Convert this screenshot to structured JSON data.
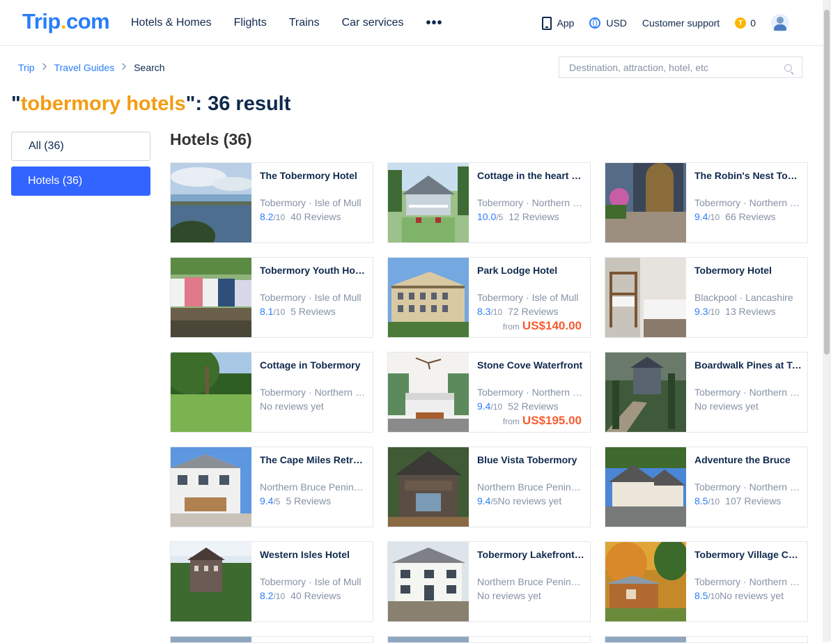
{
  "header": {
    "logo_main": "Trip",
    "logo_dot": ".",
    "logo_suffix": "com",
    "nav": [
      "Hotels & Homes",
      "Flights",
      "Trains",
      "Car services"
    ],
    "more": "•••",
    "app_label": "App",
    "currency_label": "USD",
    "support_label": "Customer support",
    "coins_count": "0",
    "coin_symbol": "T"
  },
  "breadcrumb": {
    "items": [
      "Trip",
      "Travel Guides"
    ],
    "separator": ">",
    "current": "Search"
  },
  "search": {
    "placeholder": "Destination, attraction, hotel, etc",
    "value": ""
  },
  "results": {
    "quote_open": "\"",
    "keyword": "tobermory hotels",
    "suffix": "\": 36 result"
  },
  "filters": {
    "all": "All (36)",
    "hotels": "Hotels (36)"
  },
  "section_title": "Hotels (36)",
  "cards": [
    {
      "name": "The Tobermory Hotel",
      "location": "Tobermory · Isle of Mull",
      "score": "8.2",
      "scale": "/10",
      "reviews": "40 Reviews",
      "price_from": "",
      "price": "",
      "thumb": "lake"
    },
    {
      "name": "Cottage in the heart of Tobermory",
      "location": "Tobermory · Northern Bruce Peninsula",
      "score": "10.0",
      "scale": "/5",
      "reviews": "12 Reviews",
      "price_from": "",
      "price": "",
      "thumb": "cottage"
    },
    {
      "name": "The Robin's Nest Tobermory",
      "location": "Tobermory · Northern Bruce Peninsula",
      "score": "9.4",
      "scale": "/10",
      "reviews": "66 Reviews",
      "price_from": "",
      "price": "",
      "thumb": "deck"
    },
    {
      "name": "Tobermory Youth Hostel",
      "location": "Tobermory · Isle of Mull",
      "score": "8.1",
      "scale": "/10",
      "reviews": "5 Reviews",
      "price_from": "",
      "price": "",
      "thumb": "colorful"
    },
    {
      "name": "Park Lodge Hotel",
      "location": "Tobermory · Isle of Mull",
      "score": "8.3",
      "scale": "/10",
      "reviews": "72 Reviews",
      "price_from": "from",
      "price": "US$140.00",
      "thumb": "lodge"
    },
    {
      "name": "Tobermory Hotel",
      "location": "Blackpool · Lancashire",
      "score": "9.3",
      "scale": "/10",
      "reviews": "13 Reviews",
      "price_from": "",
      "price": "",
      "thumb": "bunk"
    },
    {
      "name": "Cottage in Tobermory",
      "location": "Tobermory · Northern Bruce Peninsula",
      "score": "",
      "scale": "",
      "reviews": "No reviews yet",
      "price_from": "",
      "price": "",
      "thumb": "lawn"
    },
    {
      "name": "Stone Cove Waterfront",
      "location": "Tobermory · Northern Bruce Peninsula",
      "score": "9.4",
      "scale": "/10",
      "reviews": "52 Reviews",
      "price_from": "from",
      "price": "US$195.00",
      "thumb": "bedroom"
    },
    {
      "name": "Boardwalk Pines at Tobermory",
      "location": "Tobermory · Northern Bruce Peninsula",
      "score": "",
      "scale": "",
      "reviews": "No reviews yet",
      "price_from": "",
      "price": "",
      "thumb": "boardwalk"
    },
    {
      "name": "The Cape Miles Retreat",
      "location": "Northern Bruce Peninsula",
      "score": "9.4",
      "scale": "/5",
      "reviews": "5 Reviews",
      "price_from": "",
      "price": "",
      "thumb": "whitehouse"
    },
    {
      "name": "Blue Vista Tobermory",
      "location": "Northern Bruce Peninsula",
      "score": "9.4",
      "scale": "/5",
      "reviews": "No reviews yet",
      "price_from": "",
      "price": "",
      "thumb": "chalet"
    },
    {
      "name": "Adventure the Bruce",
      "location": "Tobermory · Northern Bruce Peninsula",
      "score": "8.5",
      "scale": "/10",
      "reviews": "107 Reviews",
      "price_from": "",
      "price": "",
      "thumb": "house"
    },
    {
      "name": "Western Isles Hotel",
      "location": "Tobermory · Isle of Mull",
      "score": "8.2",
      "scale": "/10",
      "reviews": "40 Reviews",
      "price_from": "",
      "price": "",
      "thumb": "castle"
    },
    {
      "name": "Tobermory Lakefront Cottage",
      "location": "Northern Bruce Peninsula",
      "score": "",
      "scale": "",
      "reviews": "No reviews yet",
      "price_from": "",
      "price": "",
      "thumb": "white2"
    },
    {
      "name": "Tobermory Village Cabins",
      "location": "Tobermory · Northern Bruce Peninsula",
      "score": "8.5",
      "scale": "/10",
      "reviews": "No reviews yet",
      "price_from": "",
      "price": "",
      "thumb": "cabin"
    }
  ],
  "colors": {
    "brand": "#287dfa",
    "accent_keyword": "#f39c12",
    "price": "#f55d31",
    "active_filter": "#3264ff"
  }
}
